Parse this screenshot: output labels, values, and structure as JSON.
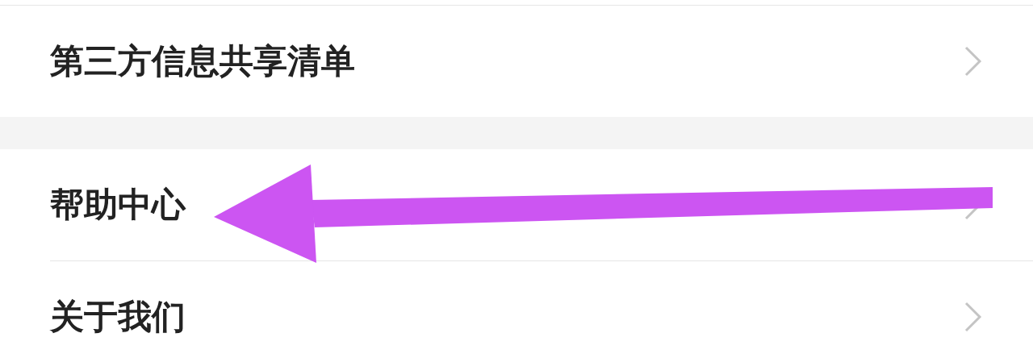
{
  "sections": [
    {
      "items": [
        {
          "label": "第三方信息共享清单"
        }
      ]
    },
    {
      "items": [
        {
          "label": "帮助中心"
        },
        {
          "label": "关于我们"
        }
      ]
    }
  ],
  "annotation": {
    "kind": "arrow",
    "color": "#cc55f2"
  }
}
